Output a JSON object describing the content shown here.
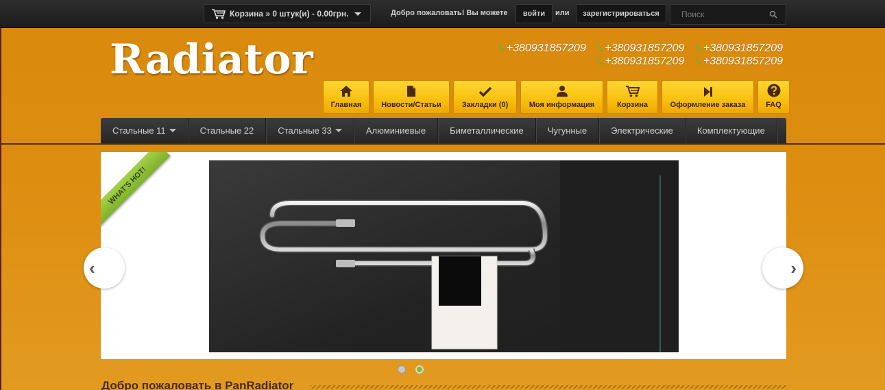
{
  "topbar": {
    "cart_label": "Корзина » 0 штук(и) - 0.00грн.",
    "welcome_text": "Добро пожаловать! Вы можете",
    "login_label": "войти",
    "or_text": "или",
    "register_label": "зарегистрироваться",
    "search_placeholder": "Поиск"
  },
  "header": {
    "logo": "Radiator",
    "phones": [
      [
        "+380931857209",
        "+380931857209",
        "+380931857209"
      ],
      [
        "+380931857209",
        "+380931857209"
      ]
    ]
  },
  "quicknav": [
    {
      "label": "Главная",
      "icon": "home-icon"
    },
    {
      "label": "Новости/Статьи",
      "icon": "document-icon"
    },
    {
      "label": "Закладки (0)",
      "icon": "checkmark-icon"
    },
    {
      "label": "Моя информация",
      "icon": "user-icon"
    },
    {
      "label": "Корзина",
      "icon": "cart-icon"
    },
    {
      "label": "Оформление заказа",
      "icon": "next-icon"
    },
    {
      "label": "FAQ",
      "icon": "question-icon"
    }
  ],
  "mainnav": [
    {
      "label": "Стальные 11",
      "dropdown": true
    },
    {
      "label": "Стальные 22",
      "dropdown": false
    },
    {
      "label": "Стальные 33",
      "dropdown": true
    },
    {
      "label": "Алюминиевые",
      "dropdown": false
    },
    {
      "label": "Биметаллические",
      "dropdown": false
    },
    {
      "label": "Чугунные",
      "dropdown": false
    },
    {
      "label": "Электрические",
      "dropdown": false
    },
    {
      "label": "Комплектующие",
      "dropdown": false
    }
  ],
  "slider": {
    "ribbon_text": "WHAT'S HOT!",
    "prev_label": "‹",
    "next_label": "›",
    "slide_count": 2,
    "active_slide": 2
  },
  "content": {
    "welcome_heading": "Добро пожаловать в PanRadiator"
  },
  "colors": {
    "accent": "#f9c413",
    "background": "#dd8d10",
    "nav": "#2e2e2e",
    "ribbon": "#8dbf33"
  }
}
